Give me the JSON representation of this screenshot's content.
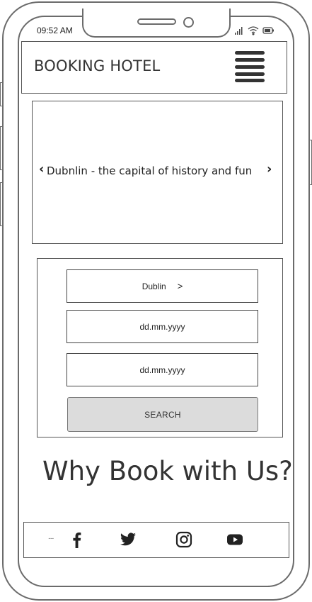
{
  "status_bar": {
    "time": "09:52 AM",
    "icons": [
      "signal-icon",
      "wifi-icon",
      "battery-icon"
    ]
  },
  "header": {
    "brand": "BOOKING HOTEL",
    "menu_icon": "hamburger-menu-icon"
  },
  "carousel": {
    "caption": "Dubnlin - the capital of history and fun",
    "prev_label": "‹",
    "next_label": "›"
  },
  "search_form": {
    "destination": "Dublin",
    "destination_chevron": ">",
    "checkin_placeholder": "dd.mm.yyyy",
    "checkout_placeholder": "dd.mm.yyyy",
    "search_label": "SEARCH"
  },
  "why": {
    "heading": "Why Book with Us?"
  },
  "footer": {
    "dots": "...",
    "social": [
      "facebook-icon",
      "twitter-icon",
      "instagram-icon",
      "youtube-icon"
    ]
  },
  "colors": {
    "frame": "#6b6b6b",
    "button_bg": "#dcdcdc",
    "text": "#333333"
  }
}
